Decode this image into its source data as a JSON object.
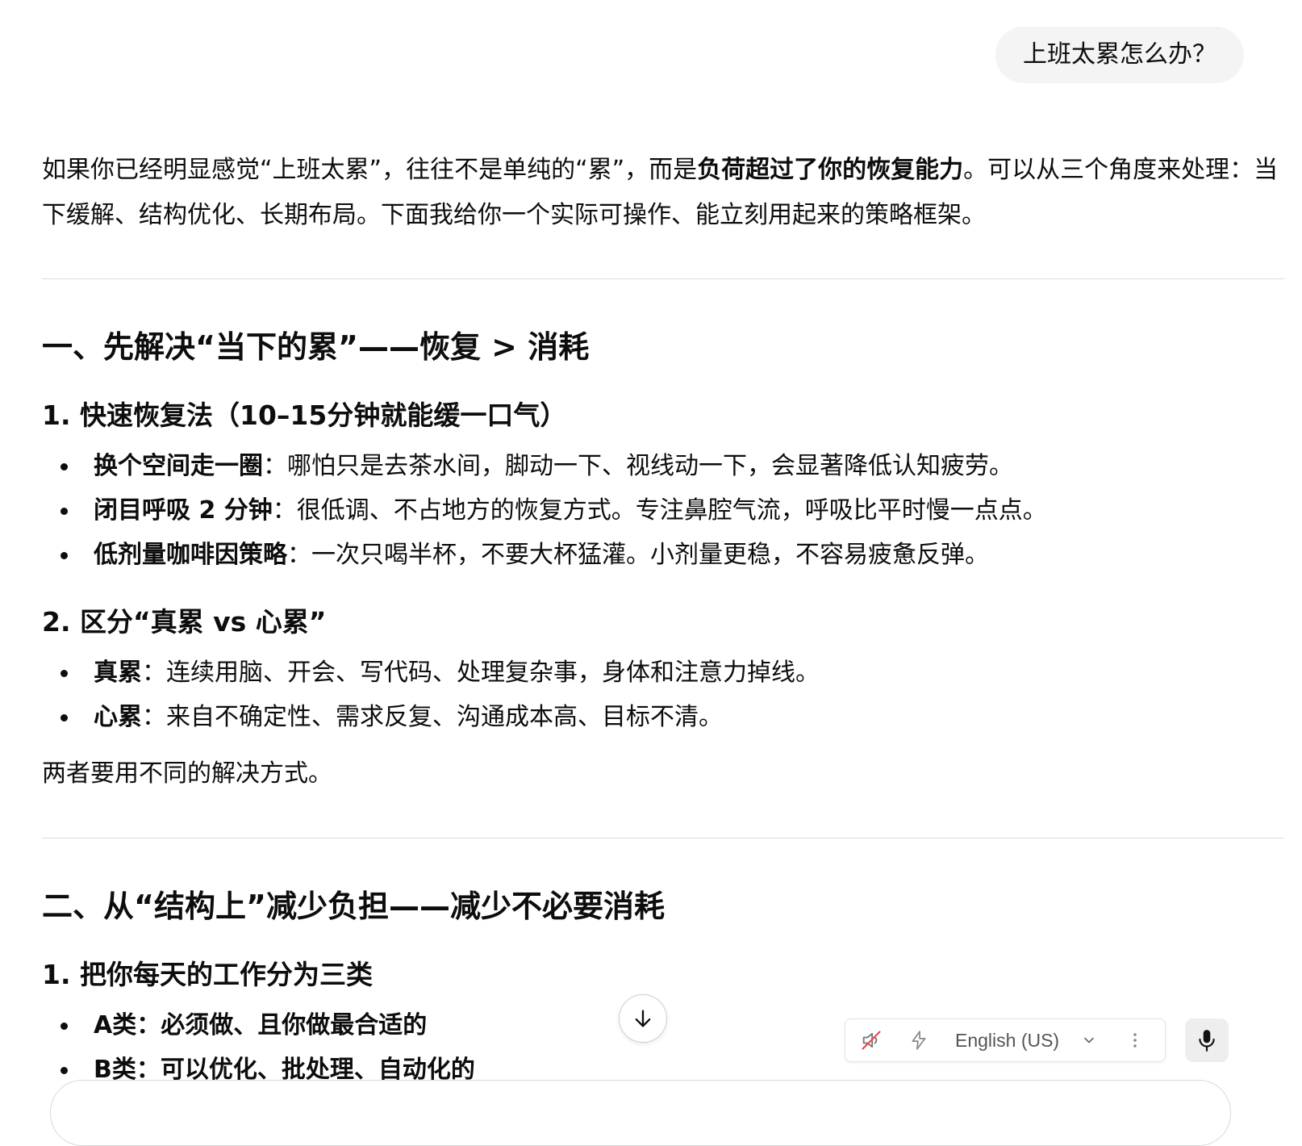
{
  "user_message": "上班太累怎么办？",
  "intro": {
    "before": "如果你已经明显感觉“上班太累”，往往不是单纯的“累”，而是",
    "bold": "负荷超过了你的恢复能力",
    "after": "。可以从三个角度来处理：当下缓解、结构优化、长期布局。下面我给你一个实际可操作、能立刻用起来的策略框架。"
  },
  "section1": {
    "title": "一、先解决“当下的累”——恢复 > 消耗",
    "sub1": {
      "title": "1. 快速恢复法（10–15分钟就能缓一口气）",
      "items": [
        {
          "term": "换个空间走一圈",
          "text": "：哪怕只是去茶水间，脚动一下、视线动一下，会显著降低认知疲劳。"
        },
        {
          "term": "闭目呼吸 2 分钟",
          "text": "：很低调、不占地方的恢复方式。专注鼻腔气流，呼吸比平时慢一点点。"
        },
        {
          "term": "低剂量咖啡因策略",
          "text": "：一次只喝半杯，不要大杯猛灌。小剂量更稳，不容易疲惫反弹。"
        }
      ]
    },
    "sub2": {
      "title": "2. 区分“真累 vs 心累”",
      "items": [
        {
          "term": "真累",
          "text": "：连续用脑、开会、写代码、处理复杂事，身体和注意力掉线。"
        },
        {
          "term": "心累",
          "text": "：来自不确定性、需求反复、沟通成本高、目标不清。"
        }
      ]
    },
    "closing": "两者要用不同的解决方式。"
  },
  "section2": {
    "title": "二、从“结构上”减少负担——减少不必要消耗",
    "sub1": {
      "title": "1. 把你每天的工作分为三类",
      "items": [
        {
          "term": "A类：必须做、且你做最合适的",
          "text": ""
        },
        {
          "term": "B类：可以优化、批处理、自动化的",
          "text": ""
        }
      ]
    }
  },
  "voice_bar": {
    "language": "English (US)",
    "icons": [
      "speaker-muted-icon",
      "lightning-icon",
      "chevron-down-icon",
      "more-vertical-icon",
      "microphone-icon"
    ]
  },
  "colors": {
    "text": "#0d0d0d",
    "bubble_bg": "#f4f4f4",
    "divider": "#dcdcdc",
    "muted_red": "#e5484d"
  }
}
